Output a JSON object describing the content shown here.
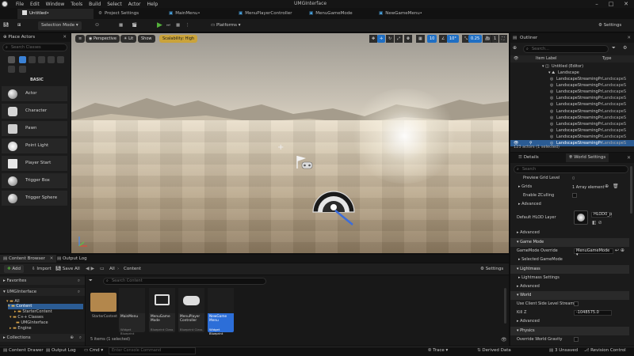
{
  "menubar": {
    "items": [
      "File",
      "Edit",
      "Window",
      "Tools",
      "Build",
      "Select",
      "Actor",
      "Help"
    ],
    "app_title": "UMGInterface"
  },
  "tabs": {
    "level": "Untitled•",
    "project_settings": "Project Settings",
    "docs": [
      "MainMenu•",
      "MenuPlayerController",
      "MenuGameMode",
      "NewGameMenu•"
    ]
  },
  "toolbar": {
    "selection_mode": "Selection Mode",
    "platforms": "Platforms",
    "settings": "Settings"
  },
  "place_actors": {
    "title": "Place Actors",
    "search_placeholder": "Search Classes",
    "category": "BASIC",
    "items": [
      "Actor",
      "Character",
      "Pawn",
      "Point Light",
      "Player Start",
      "Trigger Box",
      "Trigger Sphere"
    ]
  },
  "viewport": {
    "perspective": "Perspective",
    "lit": "Lit",
    "show": "Show",
    "scalability": "Scalability: High",
    "grid_snap": "10",
    "rot_snap": "10°",
    "scale_snap": "0.25",
    "cam_speed": "1"
  },
  "outliner": {
    "title": "Outliner",
    "search_placeholder": "Search...",
    "col_label": "Item Label",
    "col_type": "Type",
    "world": "Untitled (Editor)",
    "landscape": "Landscape",
    "proxy_name": "LandscapeStreamingPr",
    "proxy_type": "LandscapeS",
    "status": "123 actors (1 selected)"
  },
  "details": {
    "tab_details": "Details",
    "tab_world": "World Settings",
    "search_placeholder": "Search",
    "rows": {
      "preview_grid": "Preview Grid Level",
      "preview_grid_val": "0",
      "grids": "Grids",
      "grids_val": "1 Array element",
      "enable_zculling": "Enable ZCulling",
      "advanced": "Advanced",
      "hlod_layer": "Default HLOD Layer",
      "hlod_val": "HLOD0_p",
      "advanced2": "Advanced",
      "game_mode": "Game Mode",
      "gamemode_override": "GameMode Override",
      "gamemode_val": "MenuGameMode",
      "selected_gamemode": "Selected GameMode",
      "lightmass": "Lightmass",
      "lightmass_settings": "Lightmass Settings",
      "advanced3": "Advanced",
      "world": "World",
      "client_side": "Use Client Side Level Stream...",
      "kill_z": "Kill Z",
      "kill_z_val": "-1048575.0",
      "advanced4": "Advanced",
      "physics": "Physics",
      "override_gravity": "Override World Gravity"
    }
  },
  "content_browser": {
    "tab_cb": "Content Browser",
    "tab_output": "Output Log",
    "add": "Add",
    "import": "Import",
    "save_all": "Save All",
    "breadcrumb_all": "All",
    "breadcrumb_content": "Content",
    "settings": "Settings",
    "favorites": "Favorites",
    "project": "UMGInterface",
    "tree": [
      "All",
      "Content",
      "StarterContent",
      "C++ Classes",
      "UMGInterface",
      "Engine"
    ],
    "collections": "Collections",
    "search_placeholder": "Search Content",
    "status": "5 items (1 selected)",
    "assets": [
      {
        "name": "StarterContent",
        "kind": ""
      },
      {
        "name": "MainMenu",
        "kind": "Widget Blueprint"
      },
      {
        "name": "MenuGame Mode",
        "kind": "Blueprint Class"
      },
      {
        "name": "MenuPlayer Controller",
        "kind": "Blueprint Class"
      },
      {
        "name": "NewGame Menu",
        "kind": "Widget Blueprint"
      }
    ]
  },
  "statusbar": {
    "content_drawer": "Content Drawer",
    "output_log": "Output Log",
    "cmd": "Cmd",
    "console_placeholder": "Enter Console Command",
    "trace": "Trace",
    "derived_data": "Derived Data",
    "unsaved": "3 Unsaved",
    "revision": "Revision Control"
  },
  "colors": {
    "accent_blue": "#2c6ed8",
    "selection_row": "#2b5c94",
    "scalability_bg": "#caa33a",
    "play_green": "#55b33b"
  }
}
